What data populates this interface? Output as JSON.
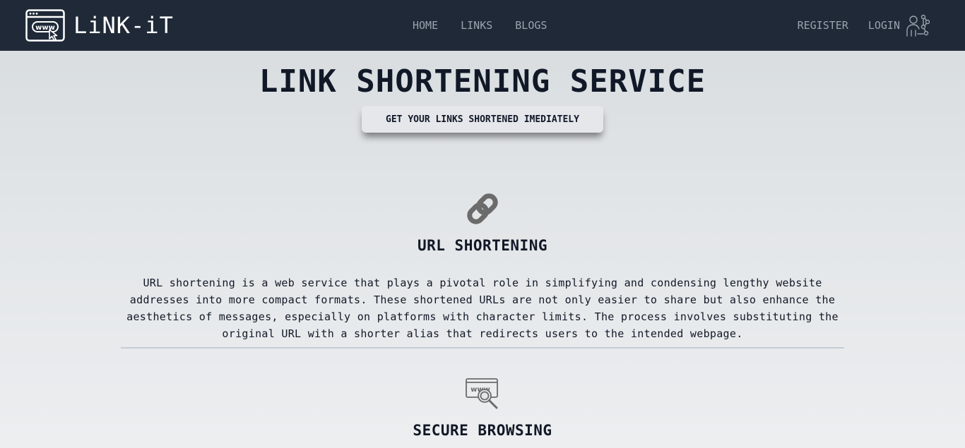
{
  "brand": {
    "name": "LiNK-iT",
    "logo_icon": "browser-www-icon"
  },
  "nav": {
    "center": [
      {
        "label": "HOME"
      },
      {
        "label": "LINKS"
      },
      {
        "label": "BLOGS"
      }
    ],
    "register_label": "REGISTER",
    "login_label": "LOGIN",
    "login_icon": "user-network-icon"
  },
  "hero": {
    "title": "LINK SHORTENING SERVICE",
    "cta_label": "GET YOUR LINKS SHORTENED IMEDIATELY"
  },
  "features": [
    {
      "icon": "link-icon",
      "title": "URL SHORTENING",
      "description": "URL shortening is a web service that plays a pivotal role in simplifying and condensing lengthy website addresses into more compact formats. These shortened URLs are not only easier to share but also enhance the aesthetics of messages, especially on platforms with character limits. The process involves substituting the original URL with a shorter alias that redirects users to the intended webpage."
    },
    {
      "icon": "www-search-icon",
      "title": "SECURE BROWSING"
    }
  ],
  "colors": {
    "navbar_bg": "#1f2937",
    "nav_text": "#9ca3af",
    "heading_text": "#111827",
    "icon_gray": "#6b6b6b"
  }
}
